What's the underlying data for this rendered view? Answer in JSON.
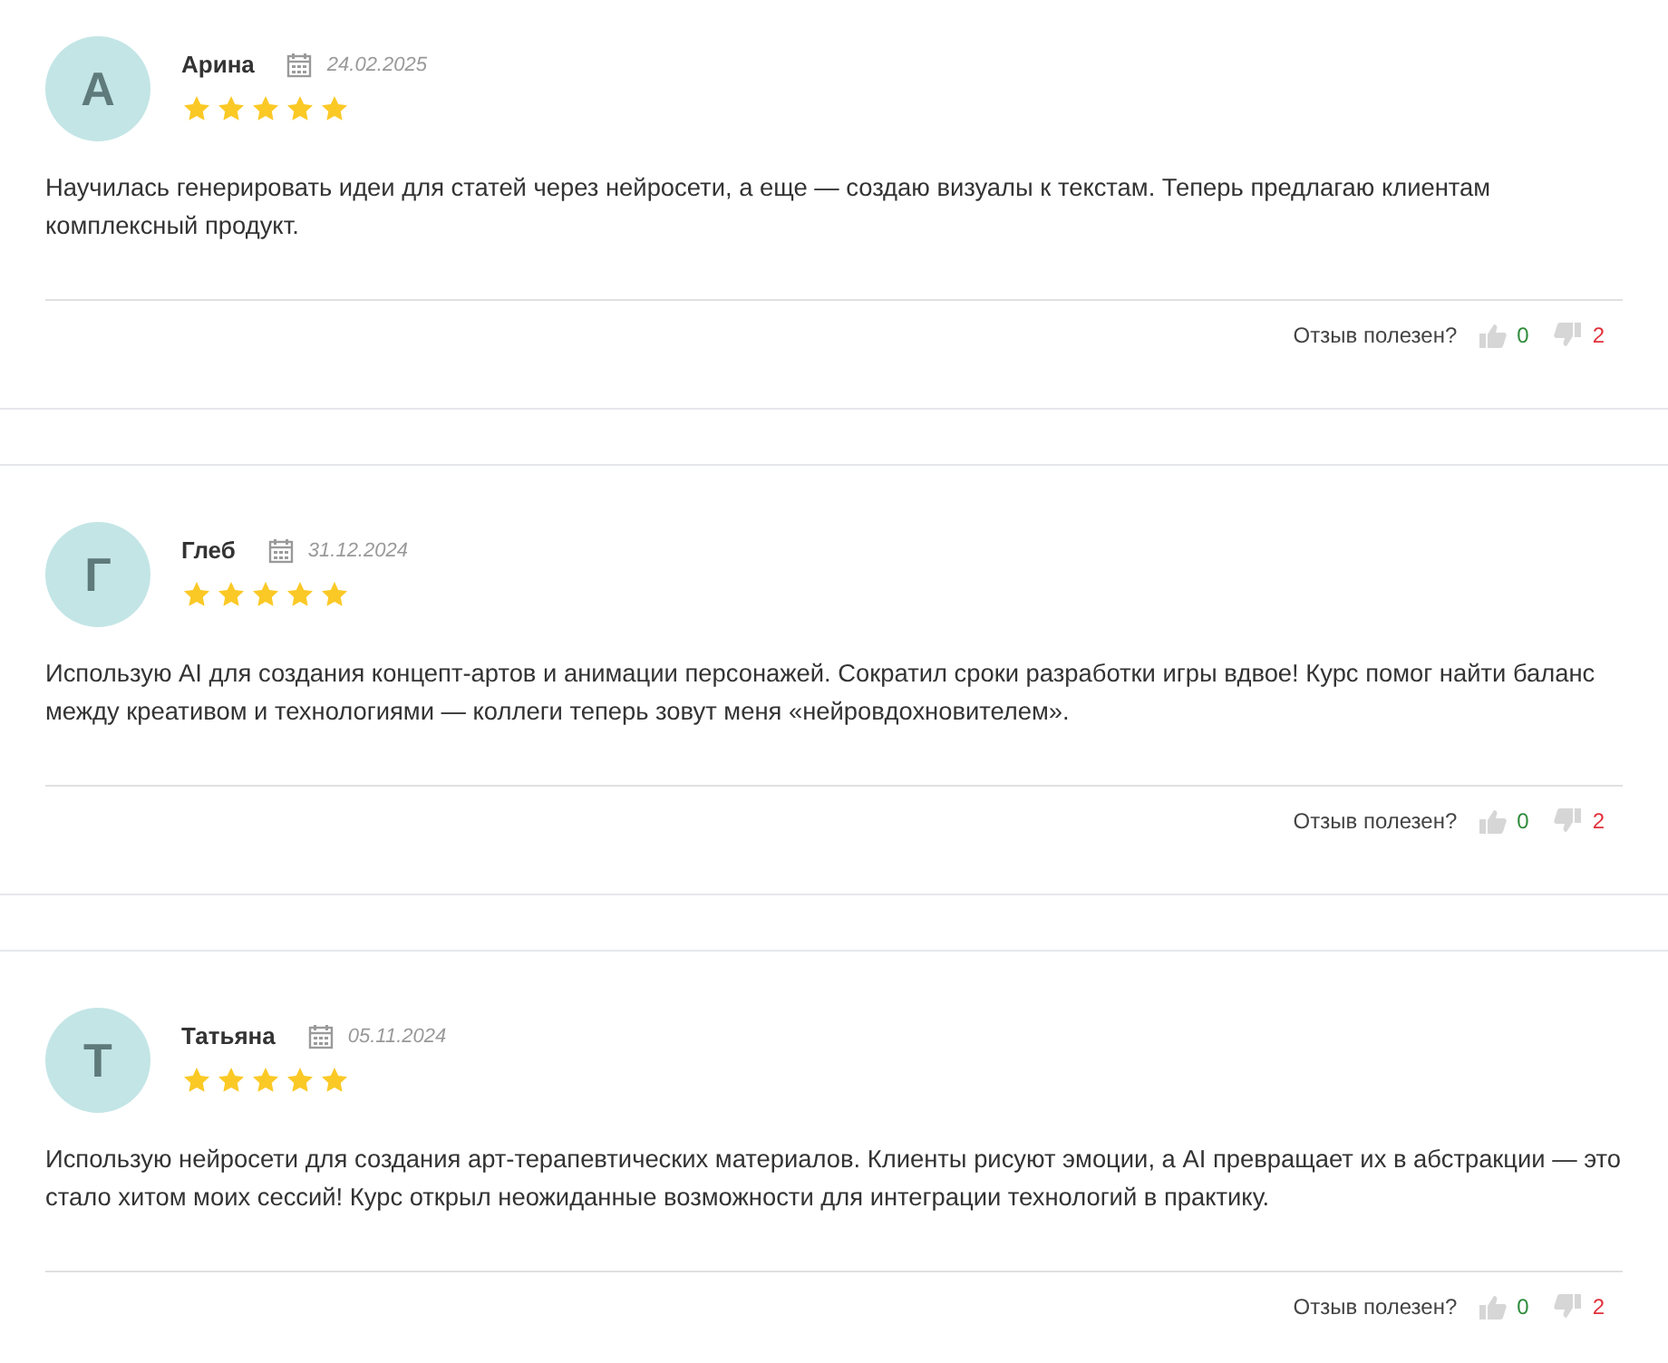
{
  "reviews": [
    {
      "initial": "А",
      "name": "Арина",
      "date": "24.02.2025",
      "stars": 5,
      "text": "Научилась генерировать идеи для статей через нейросети, а еще — создаю визуалы к текстам. Теперь предлагаю клиентам комплексный продукт.",
      "helpful_label": "Отзыв полезен?",
      "likes": "0",
      "dislikes": "2"
    },
    {
      "initial": "Г",
      "name": "Глеб",
      "date": "31.12.2024",
      "stars": 5,
      "text": "Использую AI для создания концепт-артов и анимации персонажей. Сократил сроки разработки игры вдвое! Курс помог найти баланс между креативом и технологиями — коллеги теперь зовут меня «нейровдохновителем».",
      "helpful_label": "Отзыв полезен?",
      "likes": "0",
      "dislikes": "2"
    },
    {
      "initial": "Т",
      "name": "Татьяна",
      "date": "05.11.2024",
      "stars": 5,
      "text": "Использую нейросети для создания арт-терапевтических материалов. Клиенты рисуют эмоции, а AI превращает их в абстракции — это стало хитом моих сессий! Курс открыл неожиданные возможности для интеграции технологий в практику.",
      "helpful_label": "Отзыв полезен?",
      "likes": "0",
      "dislikes": "2"
    }
  ]
}
